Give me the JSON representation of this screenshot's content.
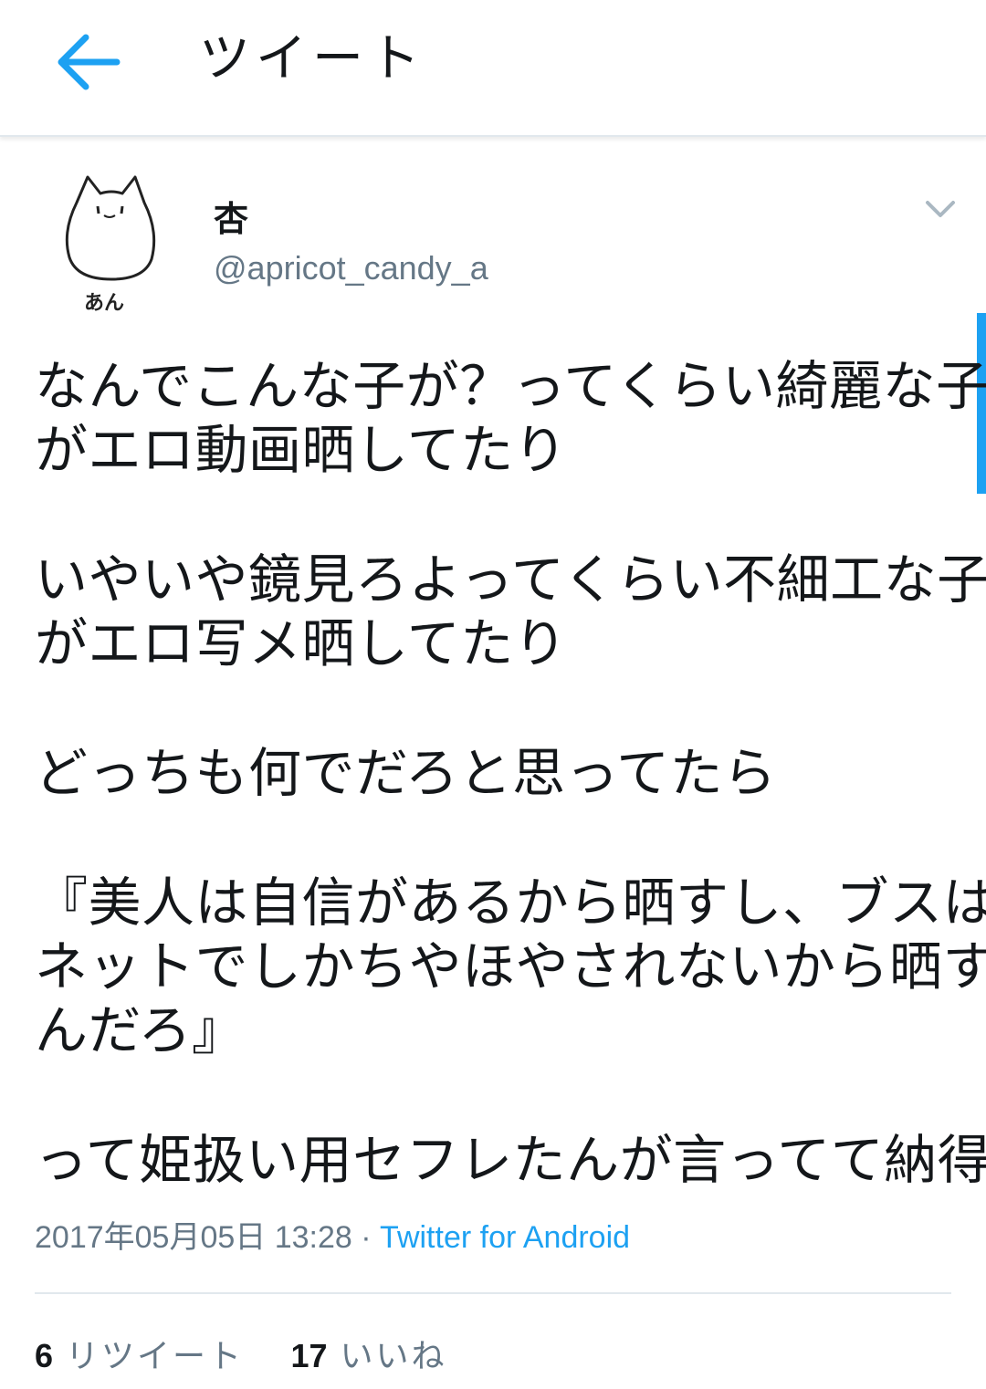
{
  "header": {
    "title": "ツイート",
    "back_icon": "arrow-left-icon",
    "accent_color": "#1da1f2"
  },
  "user": {
    "display_name": "杏",
    "handle": "@apricot_candy_a",
    "avatar_caption": "あん"
  },
  "tweet": {
    "paragraphs": [
      [
        "なんでこんな子が？ってくらい綺麗な子",
        "がエロ動画晒してたり"
      ],
      [
        "いやいや鏡見ろよってくらい不細工な子",
        "がエロ写メ晒してたり"
      ],
      [
        "どっちも何でだろと思ってたら"
      ],
      [
        "『美人は自信があるから晒すし、ブスは",
        "ネットでしかちやほやされないから晒す",
        "んだろ』"
      ],
      [
        "って姫扱い用セフレたんが言ってて納得"
      ]
    ]
  },
  "meta": {
    "timestamp": "2017年05月05日 13:28",
    "separator": "·",
    "source": "Twitter for Android"
  },
  "stats": {
    "retweets_count": "6",
    "retweets_label": "リツイート",
    "likes_count": "17",
    "likes_label": "いいね"
  }
}
